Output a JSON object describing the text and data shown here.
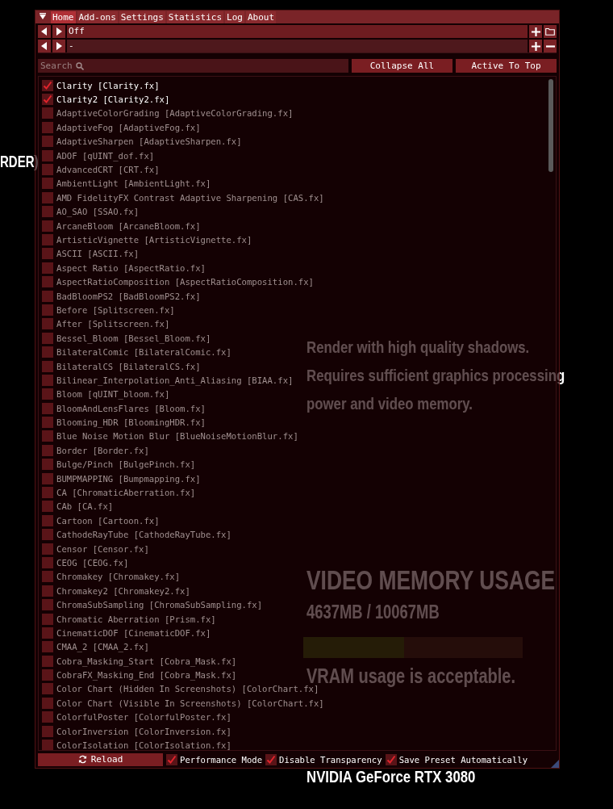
{
  "game_background": {
    "left_heading": "RDER)",
    "description": "Render with high quality shadows. Requires sufficient graphics processing power and video memory.",
    "vram": {
      "title": "VIDEO MEMORY USAGE",
      "usage": "4637MB / 10067MB",
      "level": 0.46,
      "status": "VRAM usage is acceptable."
    },
    "gpu_name": "NVIDIA GeForce RTX 3080"
  },
  "overlay": {
    "menu": [
      {
        "label": "Home",
        "selected": true
      },
      {
        "label": "Add-ons",
        "selected": false
      },
      {
        "label": "Settings",
        "selected": false
      },
      {
        "label": "Statistics",
        "selected": false
      },
      {
        "label": "Log",
        "selected": false
      },
      {
        "label": "About",
        "selected": false
      }
    ],
    "preset_rows": [
      {
        "value": "Off",
        "actions": [
          {
            "kind": "add"
          },
          {
            "kind": "open"
          }
        ]
      },
      {
        "value": "-",
        "actions": [
          {
            "kind": "add"
          },
          {
            "kind": "remove"
          }
        ]
      }
    ],
    "search": {
      "placeholder": "Search"
    },
    "buttons": [
      "Collapse All",
      "Active To Top"
    ],
    "effects": [
      {
        "label": "Clarity [Clarity.fx]",
        "checked": true
      },
      {
        "label": "Clarity2 [Clarity2.fx]",
        "checked": true
      },
      {
        "label": "AdaptiveColorGrading [AdaptiveColorGrading.fx]",
        "checked": false
      },
      {
        "label": "AdaptiveFog [AdaptiveFog.fx]",
        "checked": false
      },
      {
        "label": "AdaptiveSharpen [AdaptiveSharpen.fx]",
        "checked": false
      },
      {
        "label": "ADOF [qUINT_dof.fx]",
        "checked": false
      },
      {
        "label": "AdvancedCRT [CRT.fx]",
        "checked": false
      },
      {
        "label": "AmbientLight [AmbientLight.fx]",
        "checked": false
      },
      {
        "label": "AMD FidelityFX Contrast Adaptive Sharpening [CAS.fx]",
        "checked": false
      },
      {
        "label": "AO_SAO [SSAO.fx]",
        "checked": false
      },
      {
        "label": "ArcaneBloom [ArcaneBloom.fx]",
        "checked": false
      },
      {
        "label": "ArtisticVignette [ArtisticVignette.fx]",
        "checked": false
      },
      {
        "label": "ASCII [ASCII.fx]",
        "checked": false
      },
      {
        "label": "Aspect Ratio [AspectRatio.fx]",
        "checked": false
      },
      {
        "label": "AspectRatioComposition [AspectRatioComposition.fx]",
        "checked": false
      },
      {
        "label": "BadBloomPS2 [BadBloomPS2.fx]",
        "checked": false
      },
      {
        "label": "Before [Splitscreen.fx]",
        "checked": false
      },
      {
        "label": "After [Splitscreen.fx]",
        "checked": false
      },
      {
        "label": "Bessel_Bloom [Bessel_Bloom.fx]",
        "checked": false
      },
      {
        "label": "BilateralComic [BilateralComic.fx]",
        "checked": false
      },
      {
        "label": "BilateralCS [BilateralCS.fx]",
        "checked": false
      },
      {
        "label": "Bilinear_Interpolation_Anti_Aliasing [BIAA.fx]",
        "checked": false
      },
      {
        "label": "Bloom [qUINT_bloom.fx]",
        "checked": false
      },
      {
        "label": "BloomAndLensFlares [Bloom.fx]",
        "checked": false
      },
      {
        "label": "Blooming_HDR [BloomingHDR.fx]",
        "checked": false
      },
      {
        "label": "Blue Noise Motion Blur [BlueNoiseMotionBlur.fx]",
        "checked": false
      },
      {
        "label": "Border [Border.fx]",
        "checked": false
      },
      {
        "label": "Bulge/Pinch [BulgePinch.fx]",
        "checked": false
      },
      {
        "label": "BUMPMAPPING [Bumpmapping.fx]",
        "checked": false
      },
      {
        "label": "CA [ChromaticAberration.fx]",
        "checked": false
      },
      {
        "label": "CAb [CA.fx]",
        "checked": false
      },
      {
        "label": "Cartoon [Cartoon.fx]",
        "checked": false
      },
      {
        "label": "CathodeRayTube [CathodeRayTube.fx]",
        "checked": false
      },
      {
        "label": "Censor [Censor.fx]",
        "checked": false
      },
      {
        "label": "CEOG [CEOG.fx]",
        "checked": false
      },
      {
        "label": "Chromakey [Chromakey.fx]",
        "checked": false
      },
      {
        "label": "Chromakey2 [Chromakey2.fx]",
        "checked": false
      },
      {
        "label": "ChromaSubSampling [ChromaSubSampling.fx]",
        "checked": false
      },
      {
        "label": "Chromatic Aberration [Prism.fx]",
        "checked": false
      },
      {
        "label": "CinematicDOF [CinematicDOF.fx]",
        "checked": false
      },
      {
        "label": "CMAA_2 [CMAA_2.fx]",
        "checked": false
      },
      {
        "label": "Cobra_Masking_Start [Cobra_Mask.fx]",
        "checked": false
      },
      {
        "label": "CobraFX_Masking_End [Cobra_Mask.fx]",
        "checked": false
      },
      {
        "label": "Color Chart (Hidden In Screenshots) [ColorChart.fx]",
        "checked": false
      },
      {
        "label": "Color Chart (Visible In Screenshots) [ColorChart.fx]",
        "checked": false
      },
      {
        "label": "ColorfulPoster [ColorfulPoster.fx]",
        "checked": false
      },
      {
        "label": "ColorInversion [ColorInversion.fx]",
        "checked": false
      },
      {
        "label": "ColorIsolation [ColorIsolation.fx]",
        "checked": false
      }
    ],
    "footer": {
      "reload": "Reload",
      "options": [
        {
          "label": "Performance Mode",
          "checked": true
        },
        {
          "label": "Disable Transparency",
          "checked": true
        },
        {
          "label": "Save Preset Automatically",
          "checked": true
        }
      ]
    }
  }
}
